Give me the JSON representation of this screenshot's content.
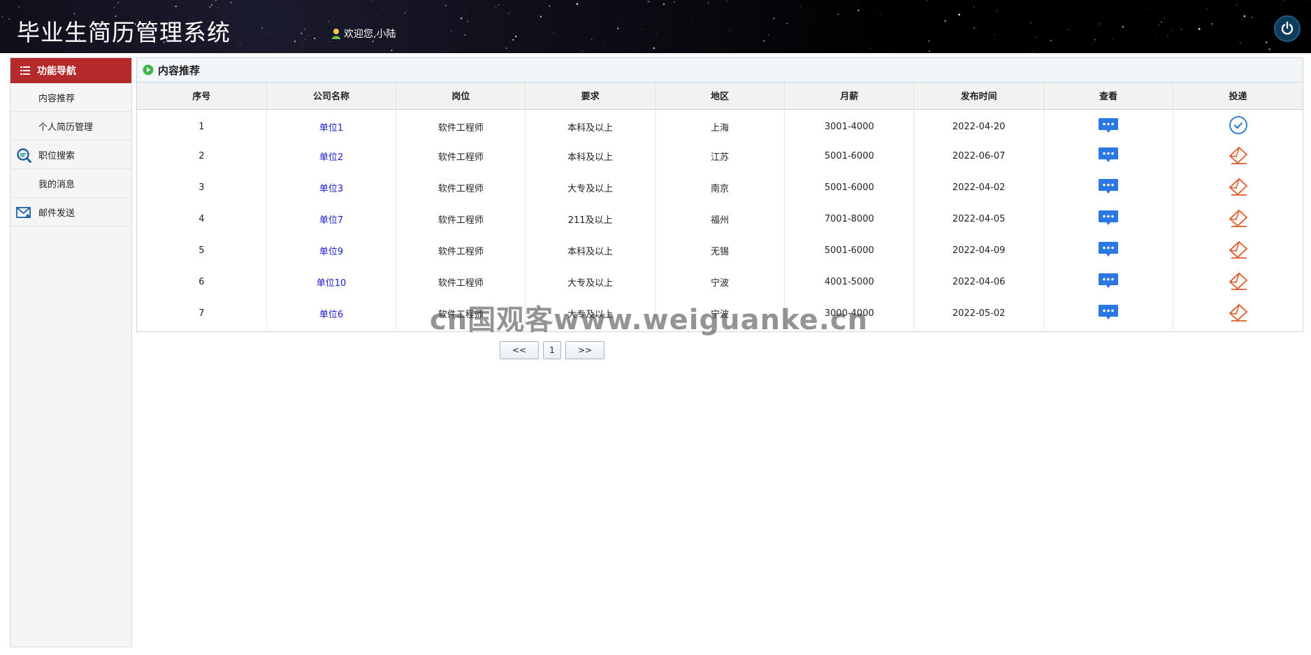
{
  "header": {
    "title": "毕业生简历管理系统",
    "welcome": "欢迎您,小陆"
  },
  "sidebar": {
    "header_label": "功能导航",
    "items": [
      {
        "label": "内容推荐",
        "icon": ""
      },
      {
        "label": "个人简历管理",
        "icon": ""
      },
      {
        "label": "职位搜索",
        "icon": "search-icon"
      },
      {
        "label": "我的消息",
        "icon": ""
      },
      {
        "label": "邮件发送",
        "icon": "mail-icon"
      }
    ]
  },
  "main": {
    "title": "内容推荐",
    "columns": [
      "序号",
      "公司名称",
      "岗位",
      "要求",
      "地区",
      "月薪",
      "发布时间",
      "查看",
      "投递"
    ],
    "rows": [
      {
        "no": "1",
        "company": "单位1",
        "position": "软件工程师",
        "requirement": "本科及以上",
        "region": "上海",
        "salary": "3001-4000",
        "date": "2022-04-20",
        "delivered": true
      },
      {
        "no": "2",
        "company": "单位2",
        "position": "软件工程师",
        "requirement": "本科及以上",
        "region": "江苏",
        "salary": "5001-6000",
        "date": "2022-06-07",
        "delivered": false
      },
      {
        "no": "3",
        "company": "单位3",
        "position": "软件工程师",
        "requirement": "大专及以上",
        "region": "南京",
        "salary": "5001-6000",
        "date": "2022-04-02",
        "delivered": false
      },
      {
        "no": "4",
        "company": "单位7",
        "position": "软件工程师",
        "requirement": "211及以上",
        "region": "福州",
        "salary": "7001-8000",
        "date": "2022-04-05",
        "delivered": false
      },
      {
        "no": "5",
        "company": "单位9",
        "position": "软件工程师",
        "requirement": "本科及以上",
        "region": "无锡",
        "salary": "5001-6000",
        "date": "2022-04-09",
        "delivered": false
      },
      {
        "no": "6",
        "company": "单位10",
        "position": "软件工程师",
        "requirement": "大专及以上",
        "region": "宁波",
        "salary": "4001-5000",
        "date": "2022-04-06",
        "delivered": false
      },
      {
        "no": "7",
        "company": "单位6",
        "position": "软件工程师",
        "requirement": "大专及以上",
        "region": "宁波",
        "salary": "3000-4000",
        "date": "2022-05-02",
        "delivered": false
      }
    ]
  },
  "pager": {
    "prev": "<<",
    "page": "1",
    "next": ">>"
  },
  "watermark": "cn国观客www.weiguanke.cn",
  "colors": {
    "nav_active": "#b52a2a",
    "link": "#1a1acd",
    "view_icon": "#2b78e4",
    "send_icon": "#e05a2b",
    "delivered_icon": "#1e73c9"
  }
}
